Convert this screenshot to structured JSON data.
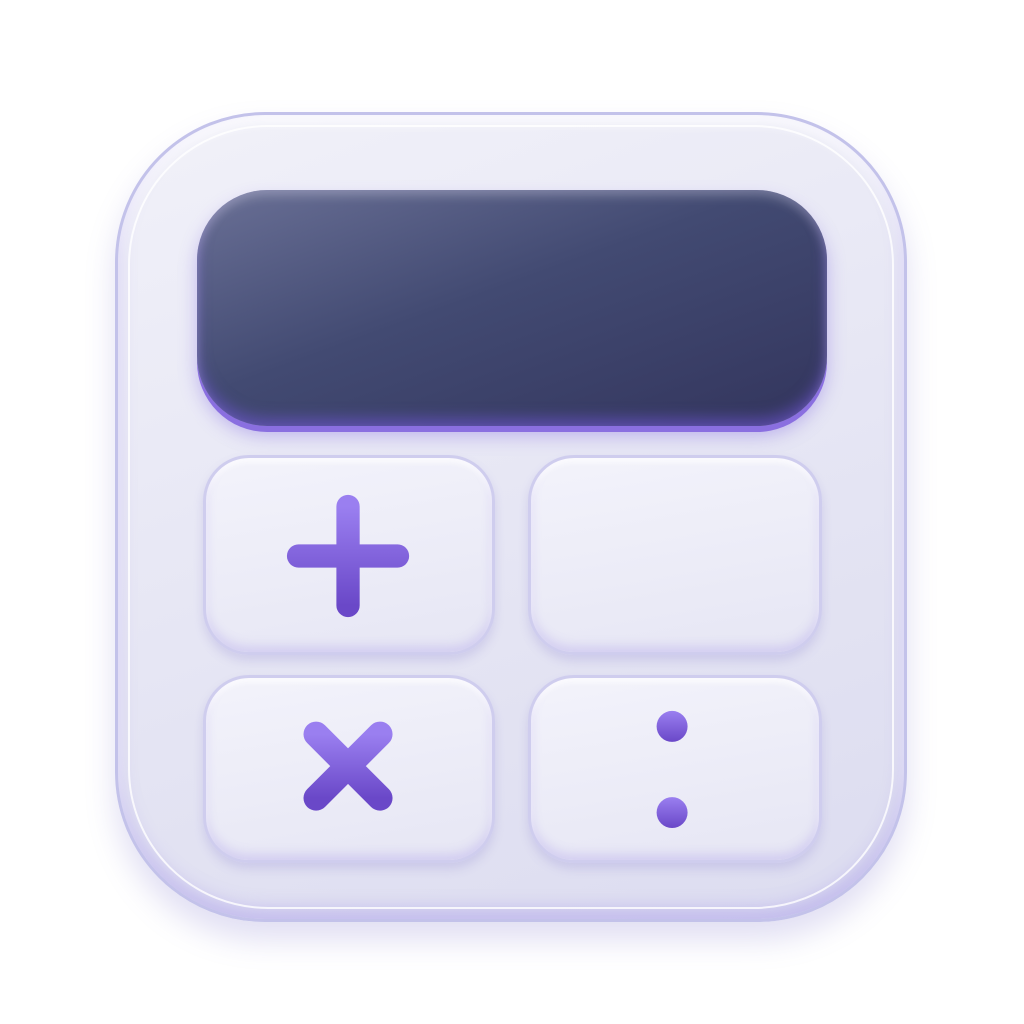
{
  "icon": {
    "name": "calculator-app-icon",
    "keys": [
      {
        "id": "plus",
        "icon": "plus-icon"
      },
      {
        "id": "minus",
        "icon": "minus-icon"
      },
      {
        "id": "times",
        "icon": "multiply-icon"
      },
      {
        "id": "divide",
        "icon": "divide-icon"
      }
    ],
    "colors": {
      "body": "#e6e6f4",
      "border": "#c3c2ea",
      "screen": "#3f4670",
      "accent": "#7b5ad8"
    }
  }
}
